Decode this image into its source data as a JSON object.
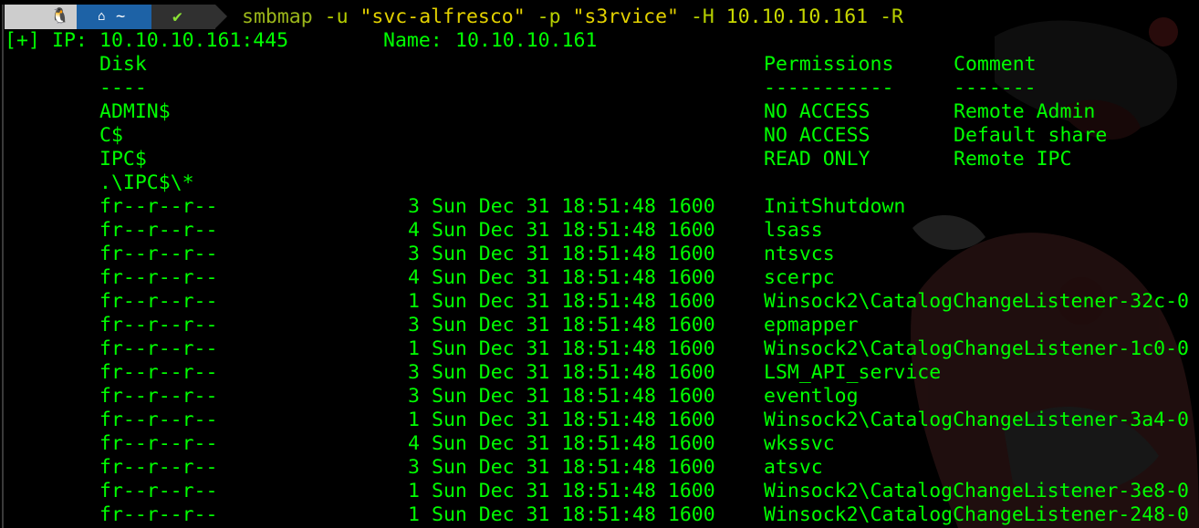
{
  "prompt": {
    "os_icon": "linux-penguin-icon",
    "home_icon": "home-icon",
    "path": "~",
    "status_icon": "check-icon",
    "status_glyph": "✔",
    "command": {
      "name": "smbmap",
      "flag_u": "-u",
      "user": "\"svc-alfresco\"",
      "flag_p": "-p",
      "password": "\"s3rvice\"",
      "flag_h": "-H",
      "host": "10.10.10.161",
      "flag_r": "-R"
    }
  },
  "output": {
    "ip_line": {
      "marker": "[+]",
      "ip_label": "IP:",
      "ip_value": "10.10.10.161:445",
      "name_label": "Name:",
      "name_value": "10.10.10.161"
    },
    "headers": {
      "disk": "Disk",
      "permissions": "Permissions",
      "comment": "Comment",
      "disk_rule": "----",
      "permissions_rule": "-----------",
      "comment_rule": "-------"
    },
    "shares": [
      {
        "disk": "ADMIN$",
        "permissions": "NO ACCESS",
        "comment": "Remote Admin"
      },
      {
        "disk": "C$",
        "permissions": "NO ACCESS",
        "comment": "Default share"
      },
      {
        "disk": "IPC$",
        "permissions": "READ ONLY",
        "comment": "Remote IPC"
      }
    ],
    "listing_path": ".\\IPC$\\*",
    "files": [
      {
        "mode": "fr--r--r--",
        "size": "3",
        "date": "Sun Dec 31 18:51:48 1600",
        "name": "InitShutdown"
      },
      {
        "mode": "fr--r--r--",
        "size": "4",
        "date": "Sun Dec 31 18:51:48 1600",
        "name": "lsass"
      },
      {
        "mode": "fr--r--r--",
        "size": "3",
        "date": "Sun Dec 31 18:51:48 1600",
        "name": "ntsvcs"
      },
      {
        "mode": "fr--r--r--",
        "size": "4",
        "date": "Sun Dec 31 18:51:48 1600",
        "name": "scerpc"
      },
      {
        "mode": "fr--r--r--",
        "size": "1",
        "date": "Sun Dec 31 18:51:48 1600",
        "name": "Winsock2\\CatalogChangeListener-32c-0"
      },
      {
        "mode": "fr--r--r--",
        "size": "3",
        "date": "Sun Dec 31 18:51:48 1600",
        "name": "epmapper"
      },
      {
        "mode": "fr--r--r--",
        "size": "1",
        "date": "Sun Dec 31 18:51:48 1600",
        "name": "Winsock2\\CatalogChangeListener-1c0-0"
      },
      {
        "mode": "fr--r--r--",
        "size": "3",
        "date": "Sun Dec 31 18:51:48 1600",
        "name": "LSM_API_service"
      },
      {
        "mode": "fr--r--r--",
        "size": "3",
        "date": "Sun Dec 31 18:51:48 1600",
        "name": "eventlog"
      },
      {
        "mode": "fr--r--r--",
        "size": "1",
        "date": "Sun Dec 31 18:51:48 1600",
        "name": "Winsock2\\CatalogChangeListener-3a4-0"
      },
      {
        "mode": "fr--r--r--",
        "size": "4",
        "date": "Sun Dec 31 18:51:48 1600",
        "name": "wkssvc"
      },
      {
        "mode": "fr--r--r--",
        "size": "3",
        "date": "Sun Dec 31 18:51:48 1600",
        "name": "atsvc"
      },
      {
        "mode": "fr--r--r--",
        "size": "1",
        "date": "Sun Dec 31 18:51:48 1600",
        "name": "Winsock2\\CatalogChangeListener-3e8-0"
      },
      {
        "mode": "fr--r--r--",
        "size": "1",
        "date": "Sun Dec 31 18:51:48 1600",
        "name": "Winsock2\\CatalogChangeListener-248-0"
      }
    ]
  },
  "colors": {
    "background": "#000000",
    "output_text": "#00ff00",
    "prompt_gray": "#cdcdcd",
    "prompt_blue": "#1d62a6",
    "prompt_dark": "#303030",
    "command_text": "#b6cf00",
    "string_text": "#e3d100"
  }
}
